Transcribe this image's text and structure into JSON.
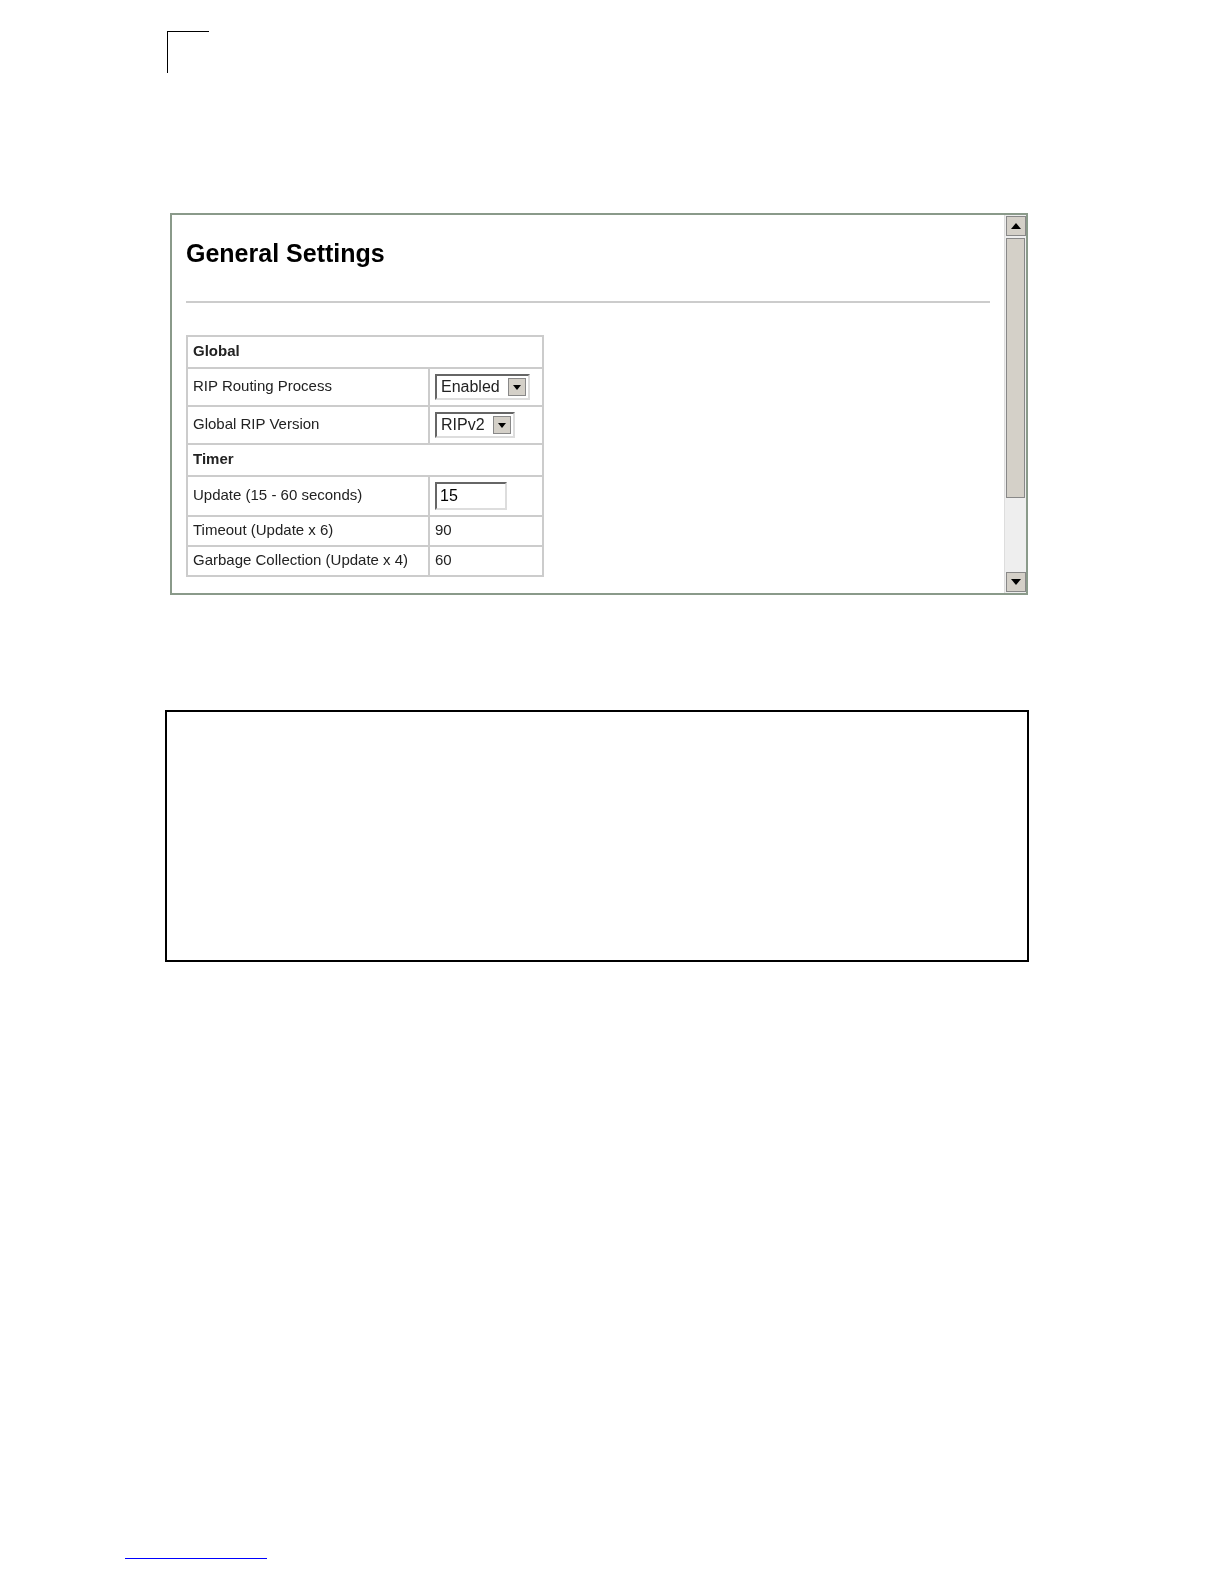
{
  "window": {
    "title": "General Settings"
  },
  "rows": [
    {
      "kind": "section",
      "label": "Global"
    },
    {
      "kind": "select",
      "label": "RIP Routing Process",
      "value": "Enabled"
    },
    {
      "kind": "select",
      "label": "Global RIP Version",
      "value": "RIPv2"
    },
    {
      "kind": "section",
      "label": "Timer"
    },
    {
      "kind": "input",
      "label": "Update (15 - 60 seconds)",
      "value": "15"
    },
    {
      "kind": "text",
      "label": "Timeout (Update x 6)",
      "value": "90"
    },
    {
      "kind": "text",
      "label": "Garbage Collection (Update x 4)",
      "value": "60"
    }
  ]
}
